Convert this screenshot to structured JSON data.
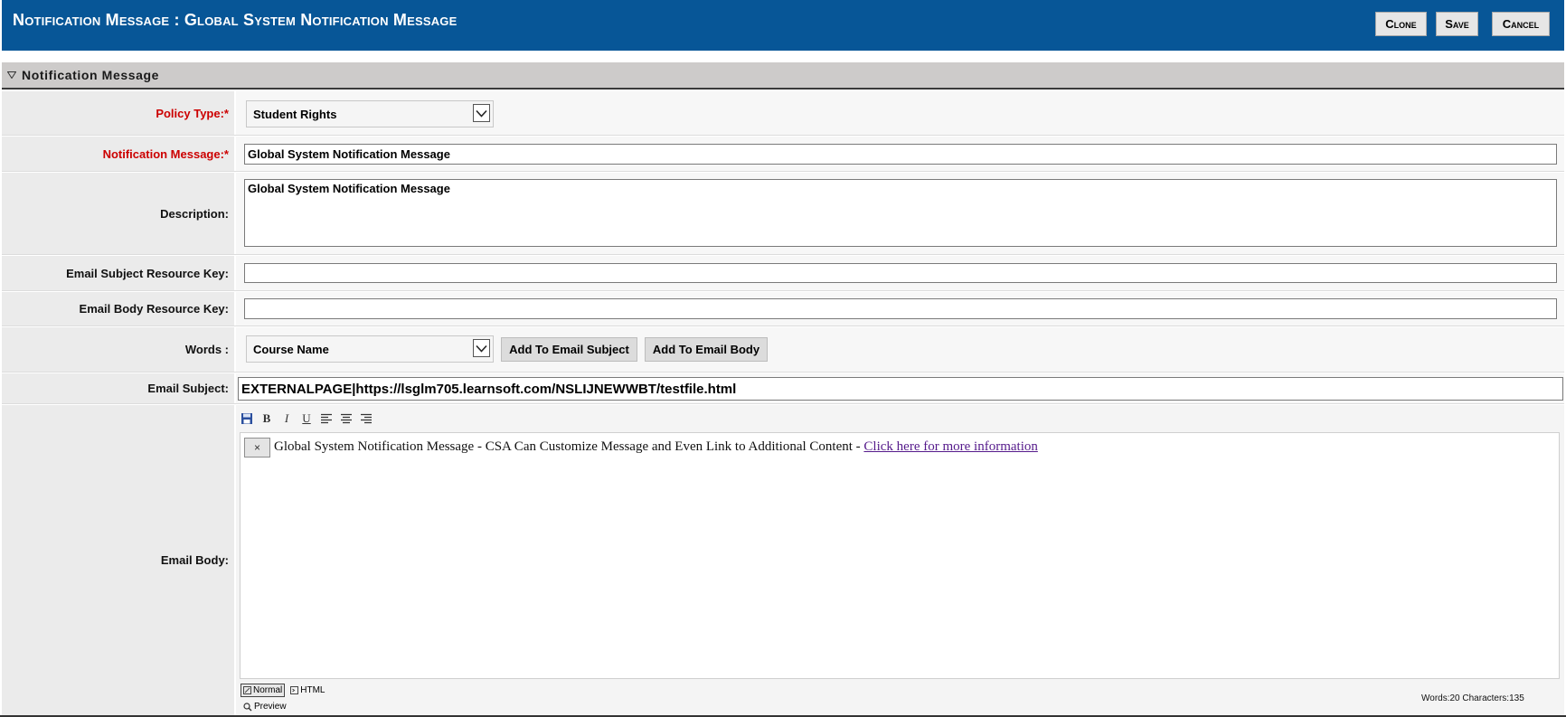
{
  "header": {
    "title": "Notification Message : Global System Notification Message",
    "buttons": {
      "clone": "Clone",
      "save": "Save",
      "cancel": "Cancel"
    },
    "colors": {
      "background": "#075697",
      "text": "#ffffff"
    }
  },
  "section": {
    "title": "Notification Message",
    "toggle_icon": "triangle-down-icon"
  },
  "form": {
    "policy_type": {
      "label": "Policy Type:*",
      "value": "Student Rights"
    },
    "notification_message": {
      "label": "Notification Message:*",
      "value": "Global System Notification Message"
    },
    "description": {
      "label": "Description:",
      "value": "Global System Notification Message"
    },
    "email_subject_resource_key": {
      "label": "Email Subject Resource Key:",
      "value": ""
    },
    "email_body_resource_key": {
      "label": "Email Body Resource Key:",
      "value": ""
    },
    "words": {
      "label": "Words :",
      "value": "Course Name",
      "add_subject_label": "Add To Email Subject",
      "add_body_label": "Add To Email Body"
    },
    "email_subject": {
      "label": "Email Subject:",
      "value": "EXTERNALPAGE|https://lsglm705.learnsoft.com/NSLIJNEWWBT/testfile.html"
    },
    "email_body": {
      "label": "Email Body:",
      "toolbar": [
        "save-icon",
        "bold-icon",
        "italic-icon",
        "underline-icon",
        "align-left-icon",
        "align-center-icon",
        "align-right-icon"
      ],
      "toolbar_glyphs": {
        "bold": "B",
        "italic": "I",
        "underline": "U"
      },
      "remove_label": "×",
      "text": "Global System Notification Message - CSA Can Customize Message and Even Link to Additional Content - ",
      "link_text": "Click here for more information",
      "modes": {
        "normal": "Normal",
        "html": "HTML",
        "preview": "Preview"
      },
      "counter": "Words:20 Characters:135"
    }
  },
  "colors": {
    "required_label": "#cc0000",
    "link": "#551a8b",
    "section_bar": "#cdcbca",
    "label_background": "#ebebeb"
  }
}
